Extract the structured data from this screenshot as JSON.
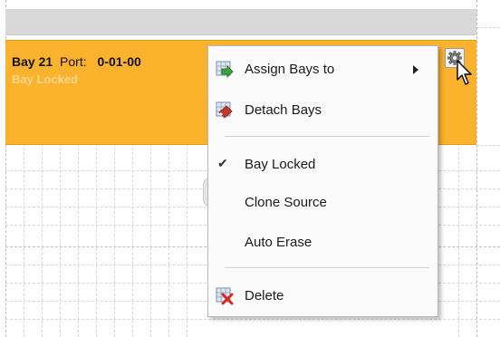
{
  "bay": {
    "name": "Bay 21",
    "port_label": "Port:",
    "port_value": "0-01-00",
    "status": "Bay Locked"
  },
  "menu": {
    "assign": "Assign Bays to",
    "detach": "Detach Bays",
    "bay_locked": "Bay Locked",
    "bay_locked_checked": true,
    "clone_source": "Clone Source",
    "auto_erase": "Auto Erase",
    "delete": "Delete"
  },
  "icons": {
    "gear": "gear-icon",
    "assign": "assign-bays-icon",
    "detach": "detach-bays-icon",
    "delete": "delete-icon",
    "submenu": "chevron-right-icon",
    "check": "checkmark-icon",
    "cursor": "mouse-pointer-icon"
  },
  "colors": {
    "bay_background": "#fbb22d",
    "bay_status_text": "#f7d88c",
    "menu_background": "#fbfbfb"
  }
}
